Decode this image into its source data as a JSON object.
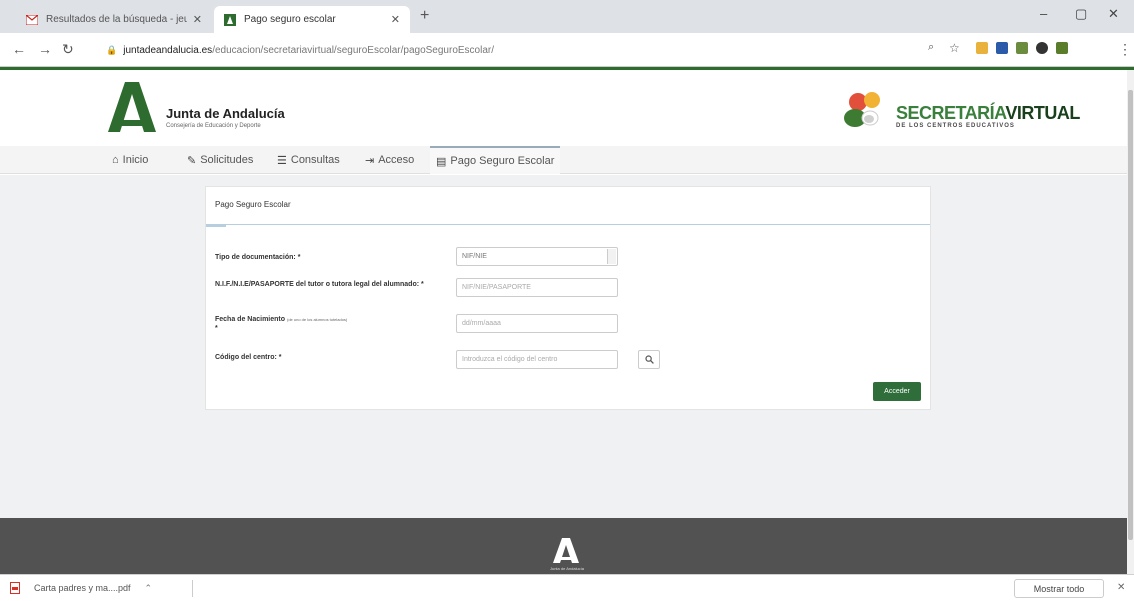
{
  "browser": {
    "tabs": [
      {
        "title": "Resultados de la búsqueda - jeu",
        "active": false
      },
      {
        "title": "Pago seguro escolar",
        "active": true
      }
    ],
    "new_tab": "+",
    "minimize": "–",
    "maximize": "▢",
    "close": "✕",
    "url_domain": "juntadeandalucia.es",
    "url_path": "/educacion/secretariavirtual/seguroEscolar/pagoSeguroEscolar/"
  },
  "header": {
    "org_name": "Junta de Andalucía",
    "org_sub": "Consejería de Educación y Deporte",
    "sv_title_1": "SECRETARÍA",
    "sv_title_2": "VIRTUAL",
    "sv_subtitle": "DE LOS CENTROS EDUCATIVOS"
  },
  "nav": {
    "inicio": "Inicio",
    "solicitudes": "Solicitudes",
    "consultas": "Consultas",
    "acceso": "Acceso",
    "pago": "Pago Seguro Escolar"
  },
  "form": {
    "title": "Pago Seguro Escolar",
    "tipo_label": "Tipo de documentación: *",
    "tipo_value": "NIF/NIE",
    "nif_label": "N.I.F./N.I.E/PASAPORTE del tutor o tutora legal del alumnado: *",
    "nif_placeholder": "NIF/NIE/PASAPORTE",
    "fecha_label": "Fecha de Nacimiento",
    "fecha_note": "(de uno de los alumnos tutelados)",
    "fecha_required": "*",
    "fecha_placeholder": "dd/mm/aaaa",
    "codigo_label": "Código del centro: *",
    "codigo_placeholder": "Introduzca el código del centro",
    "submit": "Acceder"
  },
  "footer": {
    "text": "Junta de Andalucía"
  },
  "downloads": {
    "file": "Carta padres y ma....pdf",
    "show_all": "Mostrar todo",
    "close": "✕"
  },
  "colors": {
    "junta_green": "#2e6b2f",
    "button_green": "#2f6e3a",
    "footer_gray": "#525252"
  }
}
